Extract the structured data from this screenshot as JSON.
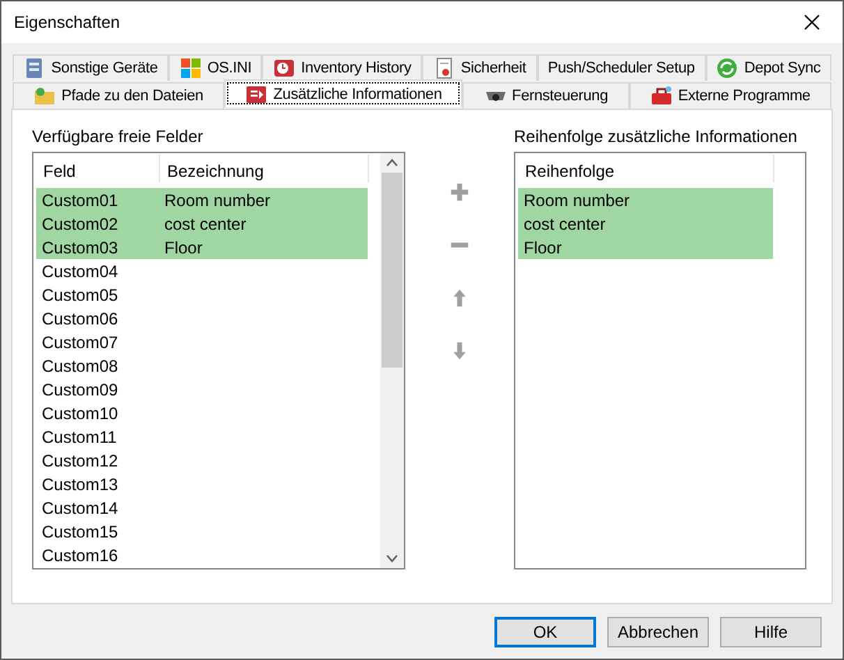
{
  "window": {
    "title": "Eigenschaften"
  },
  "tab_rows": [
    [
      {
        "label": "Sonstige Geräte",
        "selected": false
      },
      {
        "label": "OS.INI",
        "selected": false
      },
      {
        "label": "Inventory History",
        "selected": false
      },
      {
        "label": "Sicherheit",
        "selected": false
      },
      {
        "label": "Push/Scheduler Setup",
        "selected": false
      },
      {
        "label": "Depot Sync",
        "selected": false
      }
    ],
    [
      {
        "label": "Pfade zu den Dateien",
        "selected": false
      },
      {
        "label": "Zusätzliche Informationen",
        "selected": true
      },
      {
        "label": "Fernsteuerung",
        "selected": false
      },
      {
        "label": "Externe Programme",
        "selected": false
      }
    ]
  ],
  "available": {
    "label": "Verfügbare freie Felder",
    "columns": [
      "Feld",
      "Bezeichnung"
    ],
    "rows": [
      {
        "cells": [
          "Custom01",
          "Room number"
        ],
        "selected": true
      },
      {
        "cells": [
          "Custom02",
          "cost center"
        ],
        "selected": true
      },
      {
        "cells": [
          "Custom03",
          "Floor"
        ],
        "selected": true
      },
      {
        "cells": [
          "Custom04"
        ],
        "selected": false
      },
      {
        "cells": [
          "Custom05"
        ],
        "selected": false
      },
      {
        "cells": [
          "Custom06"
        ],
        "selected": false
      },
      {
        "cells": [
          "Custom07"
        ],
        "selected": false
      },
      {
        "cells": [
          "Custom08"
        ],
        "selected": false
      },
      {
        "cells": [
          "Custom09"
        ],
        "selected": false
      },
      {
        "cells": [
          "Custom10"
        ],
        "selected": false
      },
      {
        "cells": [
          "Custom11"
        ],
        "selected": false
      },
      {
        "cells": [
          "Custom12"
        ],
        "selected": false
      },
      {
        "cells": [
          "Custom13"
        ],
        "selected": false
      },
      {
        "cells": [
          "Custom14"
        ],
        "selected": false
      },
      {
        "cells": [
          "Custom15"
        ],
        "selected": false
      },
      {
        "cells": [
          "Custom16"
        ],
        "selected": false
      }
    ]
  },
  "tools": [
    {
      "kind": "add",
      "disabled": true
    },
    {
      "kind": "remove",
      "disabled": true
    },
    {
      "kind": "up",
      "disabled": true
    },
    {
      "kind": "down",
      "disabled": true
    }
  ],
  "order": {
    "label": "Reihenfolge zusätzliche Informationen",
    "columns": [
      "Reihenfolge"
    ],
    "rows": [
      {
        "cells": [
          "Room number"
        ],
        "selected": true
      },
      {
        "cells": [
          "cost center"
        ],
        "selected": true
      },
      {
        "cells": [
          "Floor"
        ],
        "selected": true
      }
    ]
  },
  "buttons": [
    {
      "label": "OK",
      "default": true
    },
    {
      "label": "Abbrechen",
      "default": false
    },
    {
      "label": "Hilfe",
      "default": false
    }
  ]
}
